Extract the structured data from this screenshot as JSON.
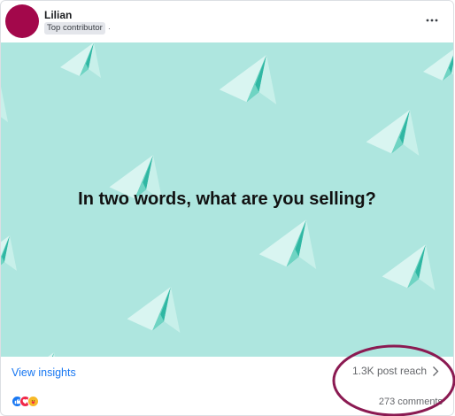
{
  "post": {
    "author": {
      "name": "Lilian",
      "badge": "Top contributor",
      "separator": "·",
      "avatar_color": "#a3084b"
    },
    "menu_icon": "more-horizontal-icon",
    "media": {
      "text": "In two words, what are you selling?",
      "background_color": "#aee6df",
      "pattern_icon": "paper-plane-icon"
    },
    "footer": {
      "insights_label": "View insights",
      "reach_label": "1.3K post reach",
      "reach_icon": "chevron-right-icon",
      "reactions": [
        "like",
        "love",
        "care"
      ],
      "comments_label": "273 comments"
    },
    "annotation": {
      "shape": "ellipse",
      "color": "#8b1a52"
    },
    "colors": {
      "link": "#1877f2",
      "muted_text": "#65676b",
      "like": "#1877f2",
      "love": "#f02849",
      "care": "#f7b928"
    }
  }
}
